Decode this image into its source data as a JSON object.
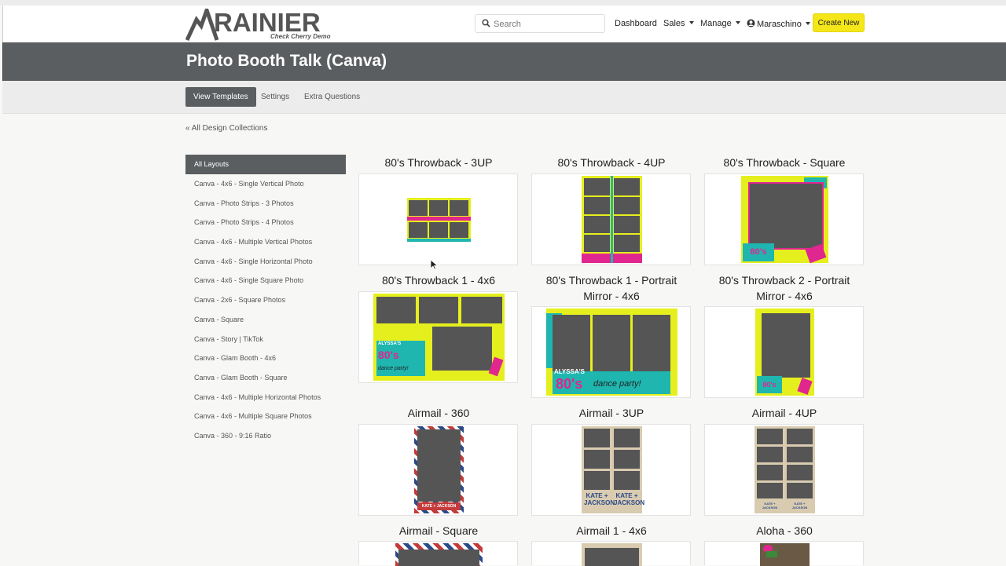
{
  "brand": {
    "name": "RAINIER",
    "subtitle": "Check Cherry Demo"
  },
  "search": {
    "placeholder": "Search",
    "value": ""
  },
  "nav": {
    "dashboard": "Dashboard",
    "sales": "Sales",
    "manage": "Manage",
    "user": "Maraschino",
    "create_new": "Create New"
  },
  "page": {
    "title": "Photo Booth Talk (Canva)"
  },
  "tabs": {
    "view_templates": "View Templates",
    "settings": "Settings",
    "extra_questions": "Extra Questions"
  },
  "back_link": "« All Design Collections",
  "sidebar": {
    "items": [
      "All Layouts",
      "Canva - 4x6 - Single Vertical Photo",
      "Canva - Photo Strips - 3 Photos",
      "Canva - Photo Strips - 4 Photos",
      "Canva - 4x6 - Multiple Vertical Photos",
      "Canva - 4x6 - Single Horizontal Photo",
      "Canva - 4x6 - Single Square Photo",
      "Canva - 2x6 - Square Photos",
      "Canva - Square",
      "Canva - Story | TikTok",
      "Canva - Glam Booth - 4x6",
      "Canva - Glam Booth - Square",
      "Canva - 4x6 - Multiple Horizontal Photos",
      "Canva - 4x6 - Multiple Square Photos",
      "Canva - 360 - 9:16 Ratio"
    ]
  },
  "templates": [
    "80's Throwback - 3UP",
    "80's Throwback - 4UP",
    "80's Throwback - Square",
    "80's Throwback 1 - 4x6",
    "80's Throwback 1 - Portrait Mirror - 4x6",
    "80's Throwback 2 - Portrait Mirror - 4x6",
    "Airmail - 360",
    "Airmail - 3UP",
    "Airmail - 4UP",
    "Airmail - Square",
    "Airmail 1 - 4x6",
    "Aloha - 360"
  ],
  "thumb_text": {
    "alyssas": "ALYSSA'S",
    "eighties": "80's",
    "dance_party": "dance party!",
    "kate_jackson": "KATE + JACKSON"
  },
  "colors": {
    "header_bar": "#5b5e60",
    "create_button": "#f5e61a",
    "neon_yellow": "#e6ef1e",
    "neon_pink": "#e0268f",
    "neon_teal": "#1fb6b0",
    "photo_placeholder": "#555555"
  }
}
